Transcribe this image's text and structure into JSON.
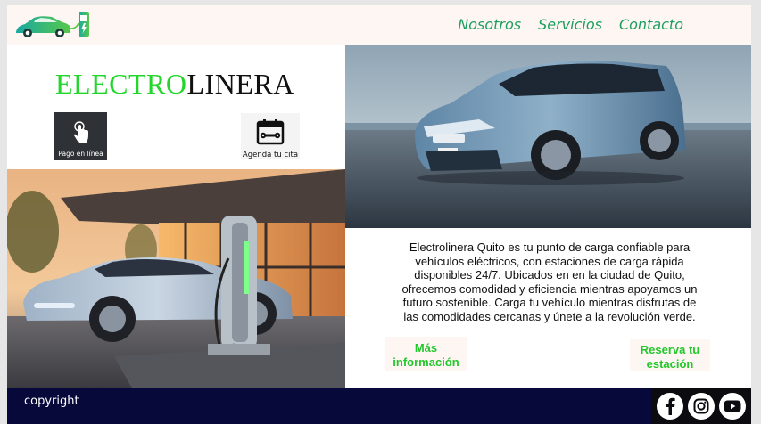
{
  "header": {
    "logo_icon": "electric-car-charging-logo",
    "nav": [
      {
        "label": "Nosotros"
      },
      {
        "label": "Servicios"
      },
      {
        "label": "Contacto"
      }
    ]
  },
  "brand": {
    "title_part1": "ELECTRO",
    "title_part2": "LINERA"
  },
  "tiles": {
    "pay_label": "Pago en línea",
    "pay_icon": "touch-hand-icon",
    "agenda_label": "Agenda tu cita",
    "agenda_icon": "calendar-wrench-icon"
  },
  "main": {
    "description": "Electrolinera Quito es tu punto de carga confiable para vehículos eléctricos, con estaciones de carga rápida disponibles 24/7. Ubicados en en la ciudad de Quito, ofrecemos comodidad y eficiencia mientras apoyamos un futuro sostenible. Carga tu vehículo mientras disfrutas de las comodidades cercanas y únete a la revolución verde.",
    "more_info_label": "Más información",
    "reserve_label": "Reserva tu estación"
  },
  "footer": {
    "copyright": "copyright",
    "social": [
      "facebook-icon",
      "instagram-icon",
      "youtube-icon"
    ]
  },
  "colors": {
    "accent_green": "#22d62b",
    "nav_green": "#1e9e5e",
    "footer_navy": "#07093a"
  }
}
